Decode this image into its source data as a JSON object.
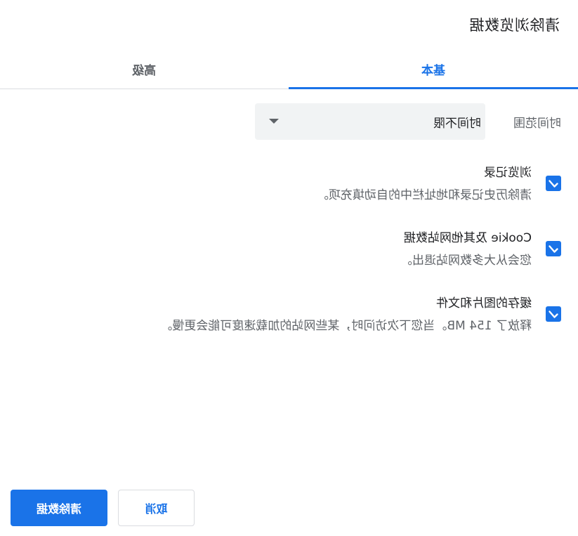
{
  "dialog": {
    "title": "清除浏览数据"
  },
  "tabs": [
    {
      "label": "基本",
      "active": true
    },
    {
      "label": "高级",
      "active": false
    }
  ],
  "time_range": {
    "label": "时间范围",
    "selected": "时间不限"
  },
  "options": [
    {
      "title": "浏览记录",
      "description": "清除历史记录和地址栏中的自动填充项。",
      "checked": true
    },
    {
      "title": "Cookie 及其他网站数据",
      "description": "您会从大多数网站退出。",
      "checked": true
    },
    {
      "title": "缓存的图片和文件",
      "description": "释放了 154 MB。当您下次访问时，某些网站的加载速度可能会更慢。",
      "checked": true
    }
  ],
  "buttons": {
    "cancel": "取消",
    "clear": "清除数据"
  },
  "colors": {
    "accent": "#1a73e8",
    "text_primary": "#202124",
    "text_secondary": "#5f6368",
    "select_bg": "#f1f3f4"
  },
  "icons": {
    "checkbox": "check-icon",
    "dropdown": "chevron-down-icon"
  }
}
